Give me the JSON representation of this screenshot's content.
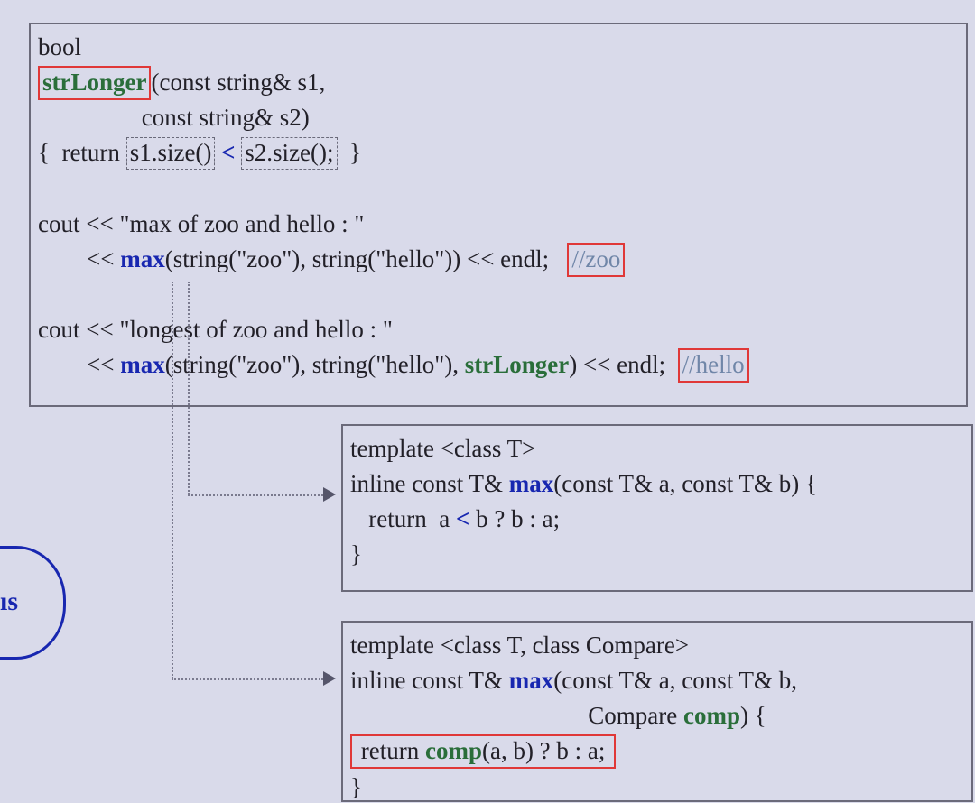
{
  "edge": {
    "text": "ıs"
  },
  "top": {
    "l1": "bool",
    "l2a": "strLonger",
    "l2b": "(const string& s1,",
    "l3": "                 const string& s2)",
    "l4a": "{  return ",
    "l4b": "s1.size()",
    "l4c": " < ",
    "l4d": "s2.size();",
    "l4e": "  }",
    "l6": "cout << \"max of zoo and hello : \"",
    "l7a": "        << ",
    "l7b": "max",
    "l7c": "(string(\"zoo\"), string(\"hello\")) << endl;   ",
    "l7d": "//zoo",
    "l9": "cout << \"longest of zoo and hello : \"",
    "l10a": "        << ",
    "l10b": "max",
    "l10c": "(string(\"zoo\"), string(\"hello\"), ",
    "l10d": "strLonger",
    "l10e": ") << endl;  ",
    "l10f": "//hello"
  },
  "mid": {
    "l1": "template <class T>",
    "l2a": "inline const T& ",
    "l2b": "max",
    "l2c": "(const T& a, const T& b) {",
    "l3a": "   return  a ",
    "l3b": "<",
    "l3c": " b ? b : a;",
    "l4": "}"
  },
  "bot": {
    "l1": "template <class T, class Compare>",
    "l2a": "inline const T& ",
    "l2b": "max",
    "l2c": "(const T& a, const T& b,",
    "l3a": "                                       Compare ",
    "l3b": "comp",
    "l3c": ") {",
    "l4a": " return ",
    "l4b": "comp",
    "l4c": "(a, b) ? b : a; ",
    "l5": "}"
  }
}
